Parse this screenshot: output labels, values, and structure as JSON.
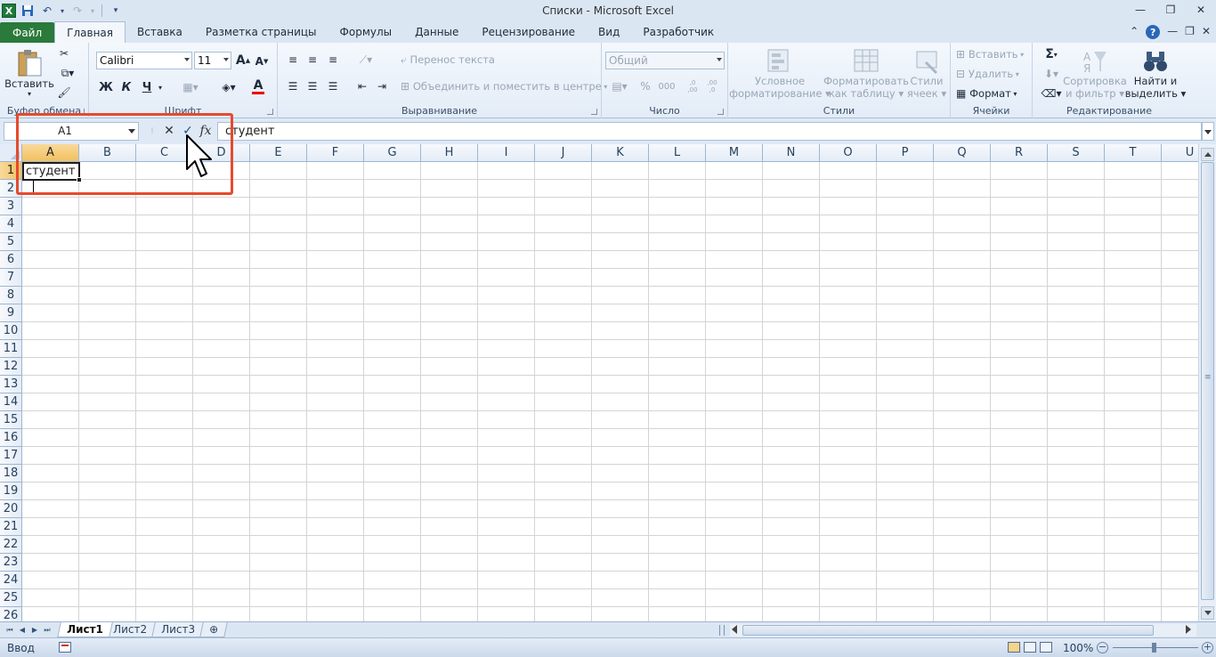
{
  "window": {
    "title": "Списки  -  Microsoft Excel",
    "app_logo": "X"
  },
  "tabs": [
    {
      "label": "Файл",
      "kind": "file"
    },
    {
      "label": "Главная",
      "kind": "active"
    },
    {
      "label": "Вставка"
    },
    {
      "label": "Разметка страницы"
    },
    {
      "label": "Формулы"
    },
    {
      "label": "Данные"
    },
    {
      "label": "Рецензирование"
    },
    {
      "label": "Вид"
    },
    {
      "label": "Разработчик"
    }
  ],
  "ribbon": {
    "clipboard": {
      "label": "Буфер обмена",
      "paste": "Вставить"
    },
    "font": {
      "label": "Шрифт",
      "font_name": "Calibri",
      "font_size": "11",
      "bold": "Ж",
      "italic": "К",
      "underline": "Ч",
      "grow": "A",
      "shrink": "A",
      "color": "A"
    },
    "alignment": {
      "label": "Выравнивание",
      "wrap": "Перенос текста",
      "merge": "Объединить и поместить в центре"
    },
    "number": {
      "label": "Число",
      "format": "Общий",
      "percent": "%",
      "thousands": "000",
      "inc_dec": ",0 ,00",
      "dec_dec": ",00 ,0"
    },
    "styles": {
      "label": "Стили",
      "conditional_1": "Условное",
      "conditional_2": "форматирование",
      "table_1": "Форматировать",
      "table_2": "как таблицу",
      "cell_1": "Стили",
      "cell_2": "ячеек"
    },
    "cells": {
      "label": "Ячейки",
      "insert": "Вставить",
      "delete": "Удалить",
      "format": "Формат"
    },
    "editing": {
      "label": "Редактирование",
      "sum": "Σ",
      "sort_1": "Сортировка",
      "sort_2": "и фильтр",
      "find_1": "Найти и",
      "find_2": "выделить"
    }
  },
  "formula_bar": {
    "name_box": "A1",
    "cancel": "✕",
    "enter": "✓",
    "fx": "fx",
    "value": "студент"
  },
  "columns": [
    "A",
    "B",
    "C",
    "D",
    "E",
    "F",
    "G",
    "H",
    "I",
    "J",
    "K",
    "L",
    "M",
    "N",
    "O",
    "P",
    "Q",
    "R",
    "S",
    "T",
    "U"
  ],
  "rows": [
    "1",
    "2",
    "3",
    "4",
    "5",
    "6",
    "7",
    "8",
    "9",
    "10",
    "11",
    "12",
    "13",
    "14",
    "15",
    "16",
    "17",
    "18",
    "19",
    "20",
    "21",
    "22",
    "23",
    "24",
    "25",
    "26"
  ],
  "active_cell": {
    "ref": "A1",
    "text": "студент"
  },
  "sheets": [
    {
      "label": "Лист1",
      "active": true
    },
    {
      "label": "Лист2"
    },
    {
      "label": "Лист3"
    }
  ],
  "status": {
    "mode": "Ввод",
    "zoom": "100%",
    "zoom_minus": "−",
    "zoom_plus": "+"
  },
  "colors": {
    "accent": "#2a7a3b",
    "highlight": "#e64a2e",
    "selected_header": "#f1c15f"
  }
}
